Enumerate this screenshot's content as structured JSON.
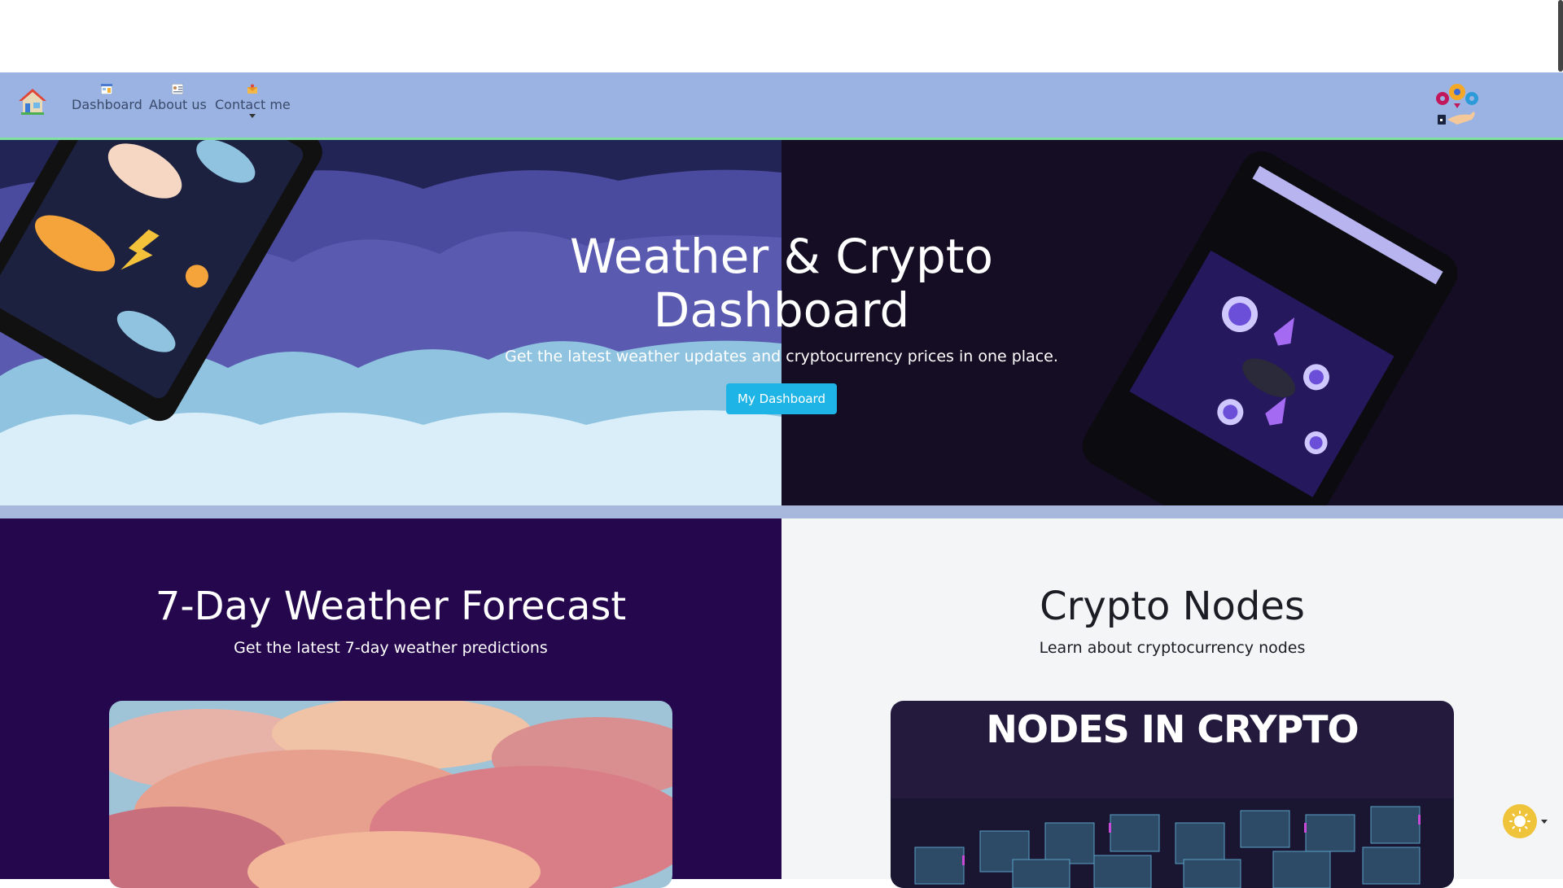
{
  "nav": {
    "items": [
      {
        "label": "Dashboard",
        "icon": "dashboard-icon"
      },
      {
        "label": "About us",
        "icon": "about-icon"
      },
      {
        "label": "Contact me",
        "icon": "contact-icon"
      }
    ],
    "home_icon": "home-icon",
    "logo_icon": "gears-logo-icon"
  },
  "hero": {
    "title_line1": "Weather & Crypto",
    "title_line2": "Dashboard",
    "subtitle": "Get the latest weather updates and cryptocurrency prices in one place.",
    "button_label": "My Dashboard"
  },
  "weather": {
    "title": "7-Day Weather Forecast",
    "subtitle": "Get the latest 7-day weather predictions"
  },
  "crypto": {
    "title": "Crypto Nodes",
    "subtitle": "Learn about cryptocurrency nodes",
    "card_heading": "NODES IN CRYPTO"
  },
  "colors": {
    "navbar": "#9ab3e2",
    "accent_button": "#1fb4e6",
    "weather_panel": "#25074d",
    "crypto_panel": "#f3f5f7",
    "theme_toggle": "#f0c43a"
  }
}
